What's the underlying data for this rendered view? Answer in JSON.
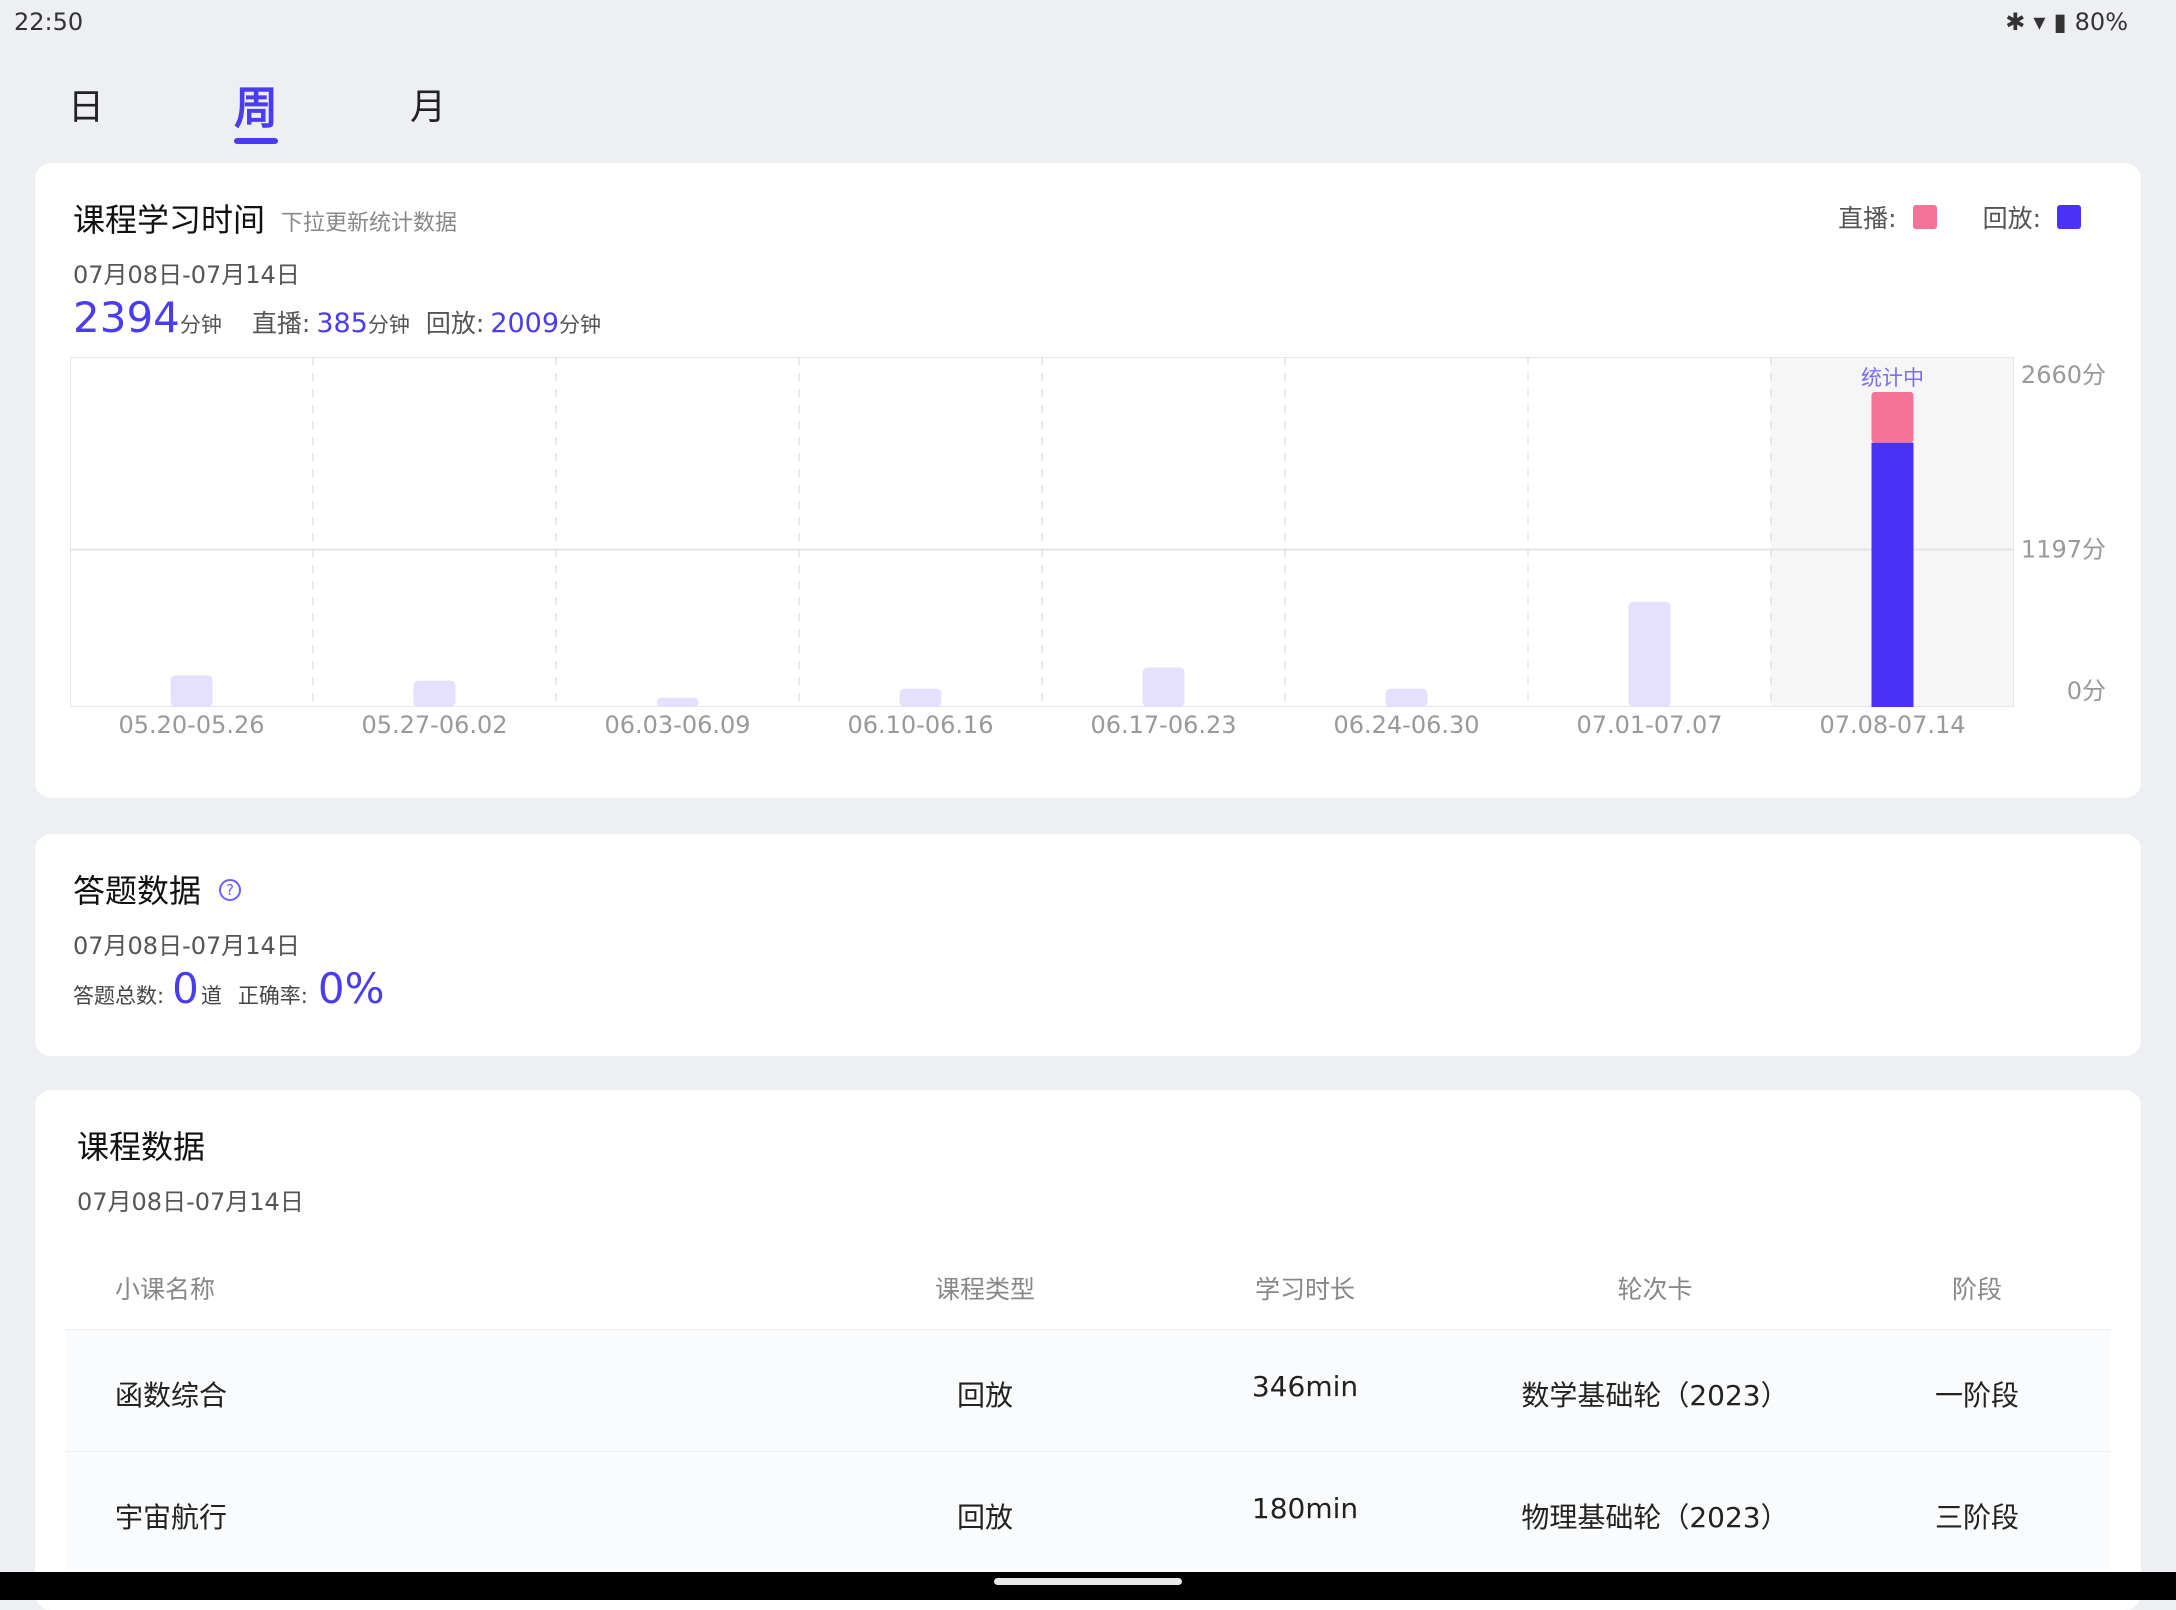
{
  "status": {
    "time": "22:50",
    "battery": "80%",
    "icons": [
      "bluetooth-icon",
      "wifi-icon",
      "battery-icon"
    ]
  },
  "period_tabs": [
    {
      "label": "日",
      "active": false
    },
    {
      "label": "周",
      "active": true
    },
    {
      "label": "月",
      "active": false
    }
  ],
  "study_time": {
    "title": "课程学习时间",
    "subtitle": "下拉更新统计数据",
    "date_range": "07月08日-07月14日",
    "total": "2394",
    "total_unit": "分钟",
    "live_label": "直播:",
    "live_value": "385",
    "live_unit": "分钟",
    "replay_label": "回放:",
    "replay_value": "2009",
    "replay_unit": "分钟",
    "legend": [
      {
        "label": "直播:",
        "color": "#f47499"
      },
      {
        "label": "回放:",
        "color": "#4a32f5"
      }
    ]
  },
  "chart_data": {
    "type": "bar",
    "categories": [
      "05.20-05.26",
      "05.27-06.02",
      "06.03-06.09",
      "06.10-06.16",
      "06.17-06.23",
      "06.24-06.30",
      "07.01-07.07",
      "07.08-07.14"
    ],
    "series": [
      {
        "name": "直播",
        "values": [
          0,
          0,
          0,
          0,
          0,
          0,
          0,
          385
        ]
      },
      {
        "name": "回放",
        "values": [
          0,
          0,
          0,
          0,
          0,
          0,
          0,
          2009
        ]
      },
      {
        "values": [
          240,
          200,
          70,
          140,
          300,
          140,
          800,
          0
        ]
      }
    ],
    "ylim": [
      0,
      2660
    ],
    "y_ticks": [
      "2660分",
      "1197分",
      "0分"
    ],
    "y_tick_values": [
      2660,
      1197,
      0
    ],
    "current_label": "统计中",
    "current_index": 7,
    "colors": {
      "live": "#f47499",
      "replay": "#4a32f5",
      "history": "#e4e0fd"
    }
  },
  "answer_data": {
    "title": "答题数据",
    "date_range": "07月08日-07月14日",
    "total_label": "答题总数:",
    "total_value": "0",
    "total_unit": "道",
    "rate_label": "正确率:",
    "rate_value": "0%"
  },
  "course_data": {
    "title": "课程数据",
    "date_range": "07月08日-07月14日",
    "columns": [
      "小课名称",
      "课程类型",
      "学习时长",
      "轮次卡",
      "阶段"
    ],
    "rows": [
      [
        "函数综合",
        "回放",
        "346min",
        "数学基础轮（2023）",
        "一阶段"
      ],
      [
        "宇宙航行",
        "回放",
        "180min",
        "物理基础轮（2023）",
        "三阶段"
      ]
    ]
  }
}
